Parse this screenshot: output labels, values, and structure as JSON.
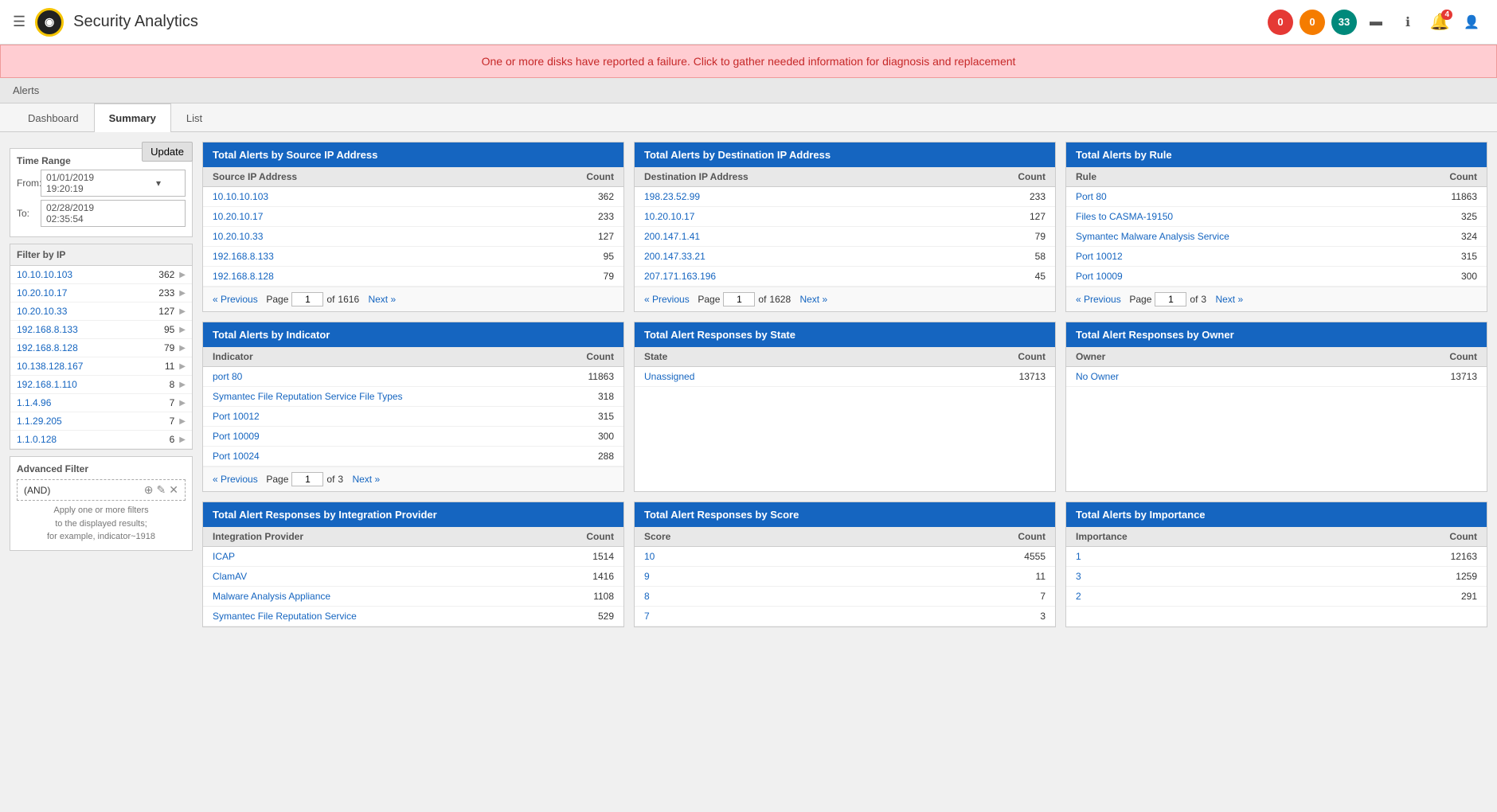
{
  "header": {
    "title": "Security Analytics",
    "logo_symbol": "◉",
    "badges": [
      {
        "label": "0",
        "color": "badge-red",
        "id": "badge-0-red"
      },
      {
        "label": "0",
        "color": "badge-orange",
        "id": "badge-0-orange"
      },
      {
        "label": "33",
        "color": "badge-teal",
        "id": "badge-33-teal"
      }
    ],
    "notification_count": "4"
  },
  "alert_banner": "One or more disks have reported a failure. Click to gather needed information for diagnosis and replacement",
  "breadcrumb": "Alerts",
  "tabs": [
    {
      "label": "Dashboard",
      "active": false
    },
    {
      "label": "Summary",
      "active": true
    },
    {
      "label": "List",
      "active": false
    }
  ],
  "update_button": "Update",
  "time_range": {
    "title": "Time Range",
    "from_label": "From:",
    "to_label": "To:",
    "from_value": "01/01/2019  19:20:19",
    "to_value": "02/28/2019  02:35:54"
  },
  "filter_by_ip": {
    "title": "Filter by IP",
    "rows": [
      {
        "ip": "10.10.10.103",
        "count": "362"
      },
      {
        "ip": "10.20.10.17",
        "count": "233"
      },
      {
        "ip": "10.20.10.33",
        "count": "127"
      },
      {
        "ip": "192.168.8.133",
        "count": "95"
      },
      {
        "ip": "192.168.8.128",
        "count": "79"
      },
      {
        "ip": "10.138.128.167",
        "count": "11"
      },
      {
        "ip": "192.168.1.110",
        "count": "8"
      },
      {
        "ip": "1.1.4.96",
        "count": "7"
      },
      {
        "ip": "1.1.29.205",
        "count": "7"
      },
      {
        "ip": "1.1.0.128",
        "count": "6"
      }
    ]
  },
  "advanced_filter": {
    "title": "Advanced Filter",
    "condition": "(AND)",
    "help_lines": [
      "Apply one or more filters",
      "to the displayed results;",
      "for example, indicator~1918"
    ]
  },
  "panels": {
    "source_ip": {
      "title": "Total Alerts by Source IP Address",
      "col1": "Source IP Address",
      "col2": "Count",
      "rows": [
        {
          "ip": "10.10.10.103",
          "count": "362"
        },
        {
          "ip": "10.20.10.17",
          "count": "233"
        },
        {
          "ip": "10.20.10.33",
          "count": "127"
        },
        {
          "ip": "192.168.8.133",
          "count": "95"
        },
        {
          "ip": "192.168.8.128",
          "count": "79"
        }
      ],
      "page": "1",
      "total_pages": "1616",
      "prev_label": "« Previous",
      "next_label": "Next »"
    },
    "dest_ip": {
      "title": "Total Alerts by Destination IP Address",
      "col1": "Destination IP Address",
      "col2": "Count",
      "rows": [
        {
          "ip": "198.23.52.99",
          "count": "233"
        },
        {
          "ip": "10.20.10.17",
          "count": "127"
        },
        {
          "ip": "200.147.1.41",
          "count": "79"
        },
        {
          "ip": "200.147.33.21",
          "count": "58"
        },
        {
          "ip": "207.171.163.196",
          "count": "45"
        }
      ],
      "page": "1",
      "total_pages": "1628",
      "prev_label": "« Previous",
      "next_label": "Next »"
    },
    "rule": {
      "title": "Total Alerts by Rule",
      "col1": "Rule",
      "col2": "Count",
      "rows": [
        {
          "ip": "Port 80",
          "count": "11863"
        },
        {
          "ip": "Files to CASMA-19150",
          "count": "325"
        },
        {
          "ip": "Symantec Malware Analysis Service",
          "count": "324"
        },
        {
          "ip": "Port 10012",
          "count": "315"
        },
        {
          "ip": "Port 10009",
          "count": "300"
        }
      ],
      "page": "1",
      "total_pages": "3",
      "prev_label": "« Previous",
      "next_label": "Next »"
    },
    "indicator": {
      "title": "Total Alerts by Indicator",
      "col1": "Indicator",
      "col2": "Count",
      "rows": [
        {
          "ip": "port 80",
          "count": "11863"
        },
        {
          "ip": "Symantec File Reputation Service File Types",
          "count": "318"
        },
        {
          "ip": "Port 10012",
          "count": "315"
        },
        {
          "ip": "Port 10009",
          "count": "300"
        },
        {
          "ip": "Port 10024",
          "count": "288"
        }
      ],
      "page": "1",
      "total_pages": "3",
      "prev_label": "« Previous",
      "next_label": "Next »"
    },
    "state": {
      "title": "Total Alert Responses by State",
      "col1": "State",
      "col2": "Count",
      "rows": [
        {
          "ip": "Unassigned",
          "count": "13713"
        }
      ],
      "no_footer": true
    },
    "owner": {
      "title": "Total Alert Responses by Owner",
      "col1": "Owner",
      "col2": "Count",
      "rows": [
        {
          "ip": "No Owner",
          "count": "13713"
        }
      ],
      "no_footer": true
    },
    "integration": {
      "title": "Total Alert Responses by Integration Provider",
      "col1": "Integration Provider",
      "col2": "Count",
      "rows": [
        {
          "ip": "ICAP",
          "count": "1514"
        },
        {
          "ip": "ClamAV",
          "count": "1416"
        },
        {
          "ip": "Malware Analysis Appliance",
          "count": "1108"
        },
        {
          "ip": "Symantec File Reputation Service",
          "count": "529"
        }
      ],
      "no_footer": true
    },
    "score": {
      "title": "Total Alert Responses by Score",
      "col1": "Score",
      "col2": "Count",
      "rows": [
        {
          "ip": "10",
          "count": "4555"
        },
        {
          "ip": "9",
          "count": "11"
        },
        {
          "ip": "8",
          "count": "7"
        },
        {
          "ip": "7",
          "count": "3"
        }
      ],
      "no_footer": true
    },
    "importance": {
      "title": "Total Alerts by Importance",
      "col1": "Importance",
      "col2": "Count",
      "rows": [
        {
          "ip": "1",
          "count": "12163"
        },
        {
          "ip": "3",
          "count": "1259"
        },
        {
          "ip": "2",
          "count": "291"
        }
      ],
      "no_footer": true
    }
  }
}
